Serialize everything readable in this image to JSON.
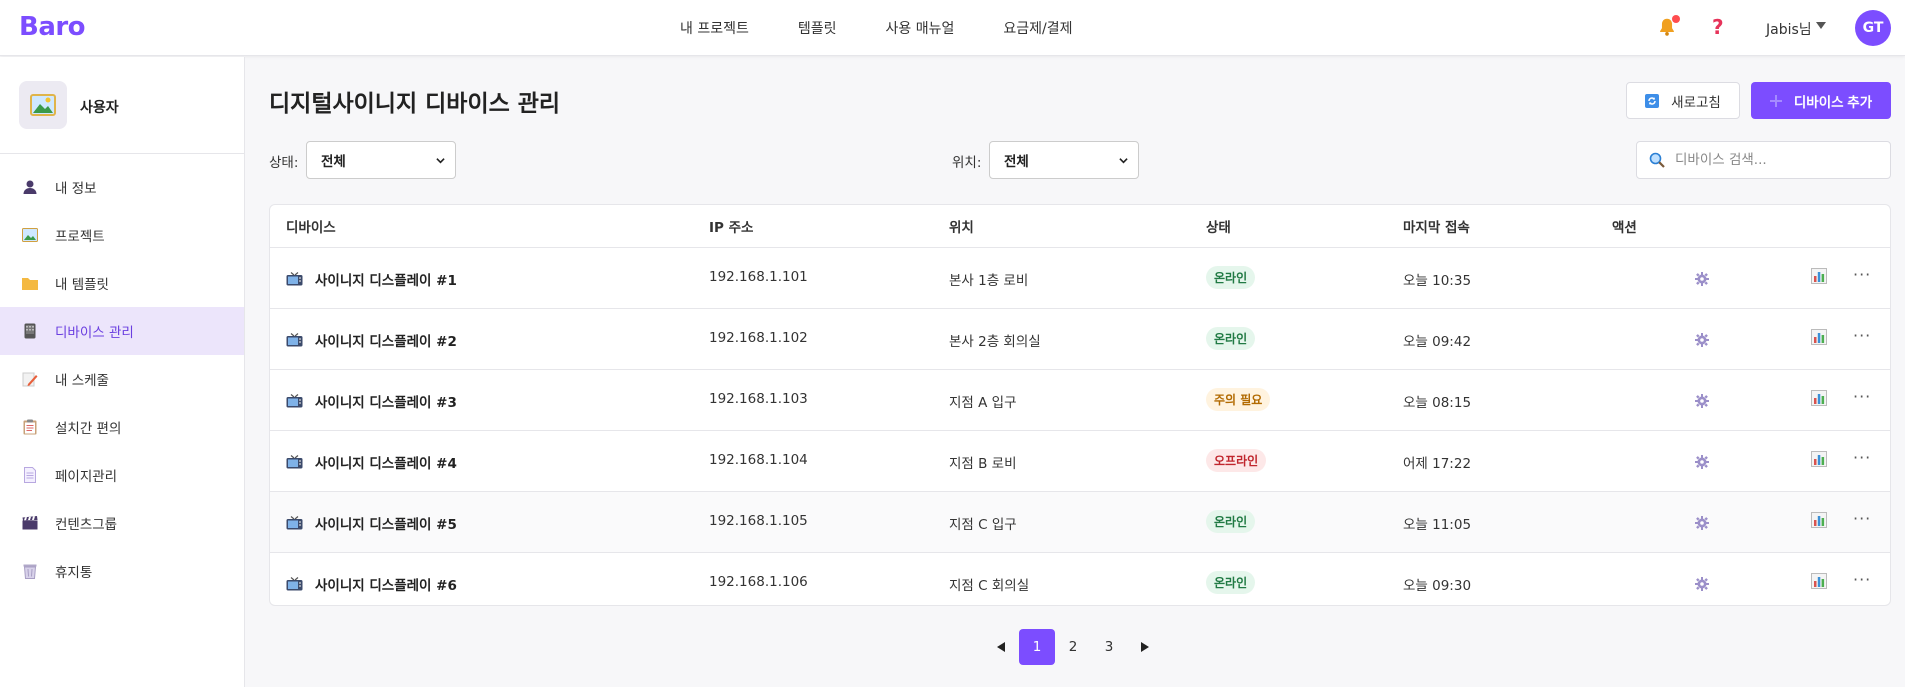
{
  "app": {
    "logo": "Baro"
  },
  "topnav": {
    "items": [
      "내 프로젝트",
      "템플릿",
      "사용 매뉴얼",
      "요금제/결제"
    ]
  },
  "user": {
    "name": "Jabis님",
    "initials": "GT"
  },
  "sidebar": {
    "profile_name": "사용자",
    "items": [
      {
        "label": "내 정보",
        "icon": "person-icon"
      },
      {
        "label": "프로젝트",
        "icon": "picture-icon"
      },
      {
        "label": "내 템플릿",
        "icon": "folder-icon"
      },
      {
        "label": "디바이스 관리",
        "icon": "device-icon",
        "active": true
      },
      {
        "label": "내 스케줄",
        "icon": "schedule-icon"
      },
      {
        "label": "설치간 편의",
        "icon": "clipboard-icon"
      },
      {
        "label": "페이지관리",
        "icon": "page-icon"
      },
      {
        "label": "컨텐츠그룹",
        "icon": "clapper-icon"
      },
      {
        "label": "휴지통",
        "icon": "trash-icon"
      }
    ]
  },
  "main": {
    "title": "디지털사이니지 디바이스 관리",
    "refresh_label": "새로고침",
    "add_label": "디바이스 추가",
    "filters": {
      "status_label": "상태:",
      "status_value": "전체",
      "location_label": "위치:",
      "location_value": "전체"
    },
    "search": {
      "placeholder": "디바이스 검색..."
    },
    "table": {
      "headers": [
        "디바이스",
        "IP 주소",
        "위치",
        "상태",
        "마지막 접속",
        "액션"
      ],
      "rows": [
        {
          "device": "사이니지 디스플레이 #1",
          "ip": "192.168.1.101",
          "location": "본사 1층 로비",
          "status": "온라인",
          "status_kind": "green",
          "last": "오늘 10:35"
        },
        {
          "device": "사이니지 디스플레이 #2",
          "ip": "192.168.1.102",
          "location": "본사 2층 회의실",
          "status": "온라인",
          "status_kind": "green",
          "last": "오늘 09:42"
        },
        {
          "device": "사이니지 디스플레이 #3",
          "ip": "192.168.1.103",
          "location": "지점 A 입구",
          "status": "주의 필요",
          "status_kind": "yellow",
          "last": "오늘 08:15"
        },
        {
          "device": "사이니지 디스플레이 #4",
          "ip": "192.168.1.104",
          "location": "지점 B 로비",
          "status": "오프라인",
          "status_kind": "red",
          "last": "어제 17:22"
        },
        {
          "device": "사이니지 디스플레이 #5",
          "ip": "192.168.1.105",
          "location": "지점 C 입구",
          "status": "온라인",
          "status_kind": "green",
          "last": "오늘 11:05"
        },
        {
          "device": "사이니지 디스플레이 #6",
          "ip": "192.168.1.106",
          "location": "지점 C 회의실",
          "status": "온라인",
          "status_kind": "green",
          "last": "오늘 09:30"
        }
      ]
    },
    "pagination": {
      "pages": [
        "1",
        "2",
        "3"
      ],
      "current": "1"
    }
  },
  "colors": {
    "accent": "#7c4dff",
    "active_bg": "#ece5fb"
  }
}
